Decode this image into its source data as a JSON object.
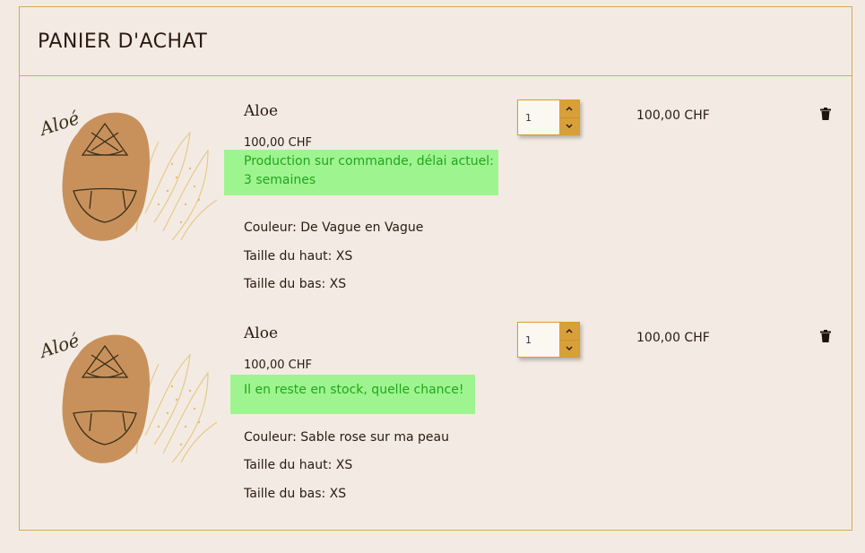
{
  "cart": {
    "title": "PANIER D'ACHAT",
    "items": [
      {
        "name": "Aloe",
        "thumb_label": "Aloé",
        "unit_price": "100,00 CHF",
        "stock_note": "Production sur commande, délai actuel: 3 semaines",
        "attributes": [
          "Couleur: De Vague en Vague",
          "Taille du haut: XS",
          "Taille du bas: XS"
        ],
        "quantity": "1",
        "line_price": "100,00 CHF"
      },
      {
        "name": "Aloe",
        "thumb_label": "Aloé",
        "unit_price": "100,00 CHF",
        "stock_note": "Il en reste en stock, quelle chance!",
        "attributes": [
          "Couleur: Sable rose sur ma peau",
          "Taille du haut: XS",
          "Taille du bas: XS"
        ],
        "quantity": "1",
        "line_price": "100,00 CHF"
      }
    ]
  },
  "icons": {
    "increment": "chevron-up-icon",
    "decrement": "chevron-down-icon",
    "delete": "trash-icon"
  },
  "colors": {
    "background": "#f3ebe3",
    "border": "#d9a654",
    "accent": "#d9a03a",
    "stock_note_bg": "#9ef58f",
    "stock_note_text": "#22a51e"
  }
}
